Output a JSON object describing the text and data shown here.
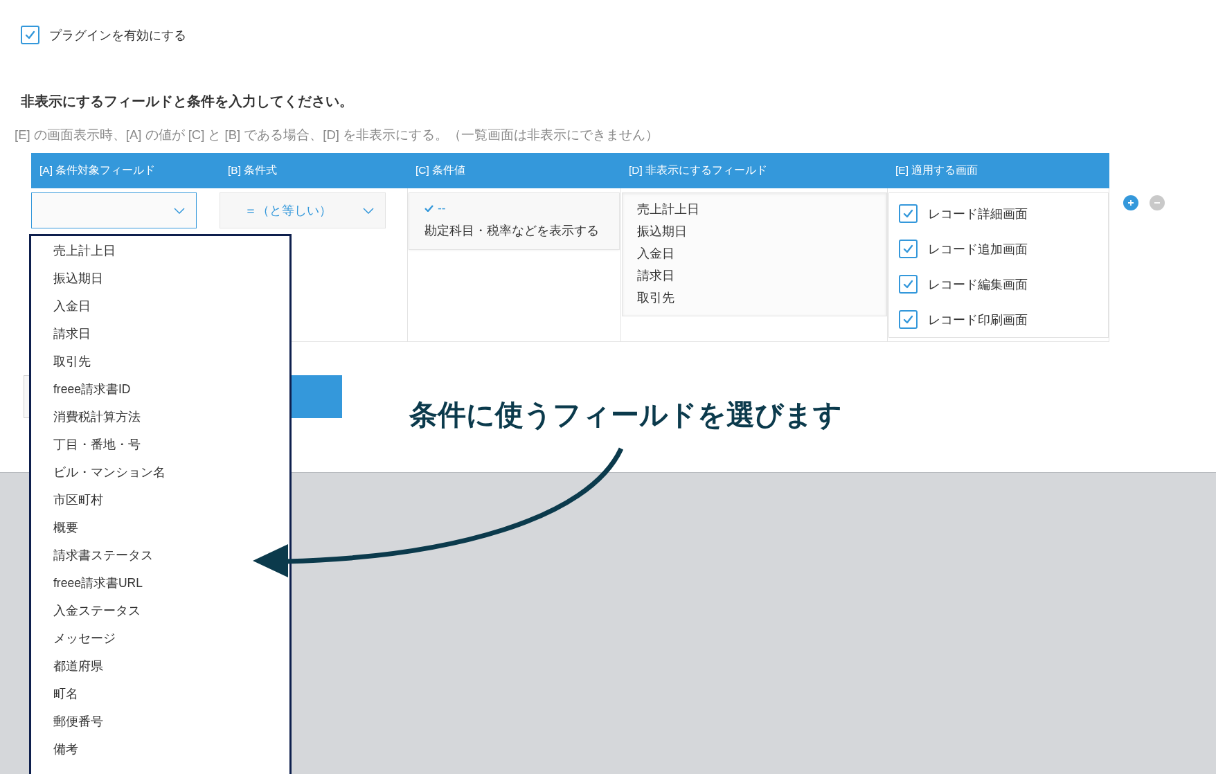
{
  "enable_plugin": {
    "label": "プラグインを有効にする",
    "checked": true
  },
  "instructions": {
    "heading": "非表示にするフィールドと条件を入力してください。",
    "description": "[E] の画面表示時、[A] の値が [C] と [B] である場合、[D] を非表示にする。（一覧画面は非表示にできません）"
  },
  "table": {
    "columns": [
      "[A] 条件対象フィールド",
      "[B] 条件式",
      "[C] 条件値",
      "[D] 非表示にするフィールド",
      "[E] 適用する画面"
    ],
    "row": {
      "condition_field": {
        "expanded": true,
        "options": [
          "売上計上日",
          "振込期日",
          "入金日",
          "請求日",
          "取引先",
          "freee請求書ID",
          "消費税計算方法",
          "丁目・番地・号",
          "ビル・マンション名",
          "市区町村",
          "概要",
          "請求書ステータス",
          "freee請求書URL",
          "入金ステータス",
          "メッセージ",
          "都道府県",
          "町名",
          "郵便番号",
          "備考"
        ]
      },
      "operator": {
        "value": "＝（と等しい）"
      },
      "condition_values": [
        {
          "label": "--",
          "selected": true
        },
        {
          "label": "勘定科目・税率などを表示する",
          "selected": false
        }
      ],
      "hidden_fields": [
        "売上計上日",
        "振込期日",
        "入金日",
        "請求日",
        "取引先"
      ],
      "screens": [
        {
          "label": "レコード詳細画面",
          "checked": true
        },
        {
          "label": "レコード追加画面",
          "checked": true
        },
        {
          "label": "レコード編集画面",
          "checked": true
        },
        {
          "label": "レコード印刷画面",
          "checked": true
        }
      ]
    }
  },
  "row_buttons": [
    {
      "kind": "add",
      "disabled": false
    },
    {
      "kind": "remove",
      "disabled": true
    }
  ],
  "annotation": {
    "text": "条件に使うフィールドを選びます"
  }
}
